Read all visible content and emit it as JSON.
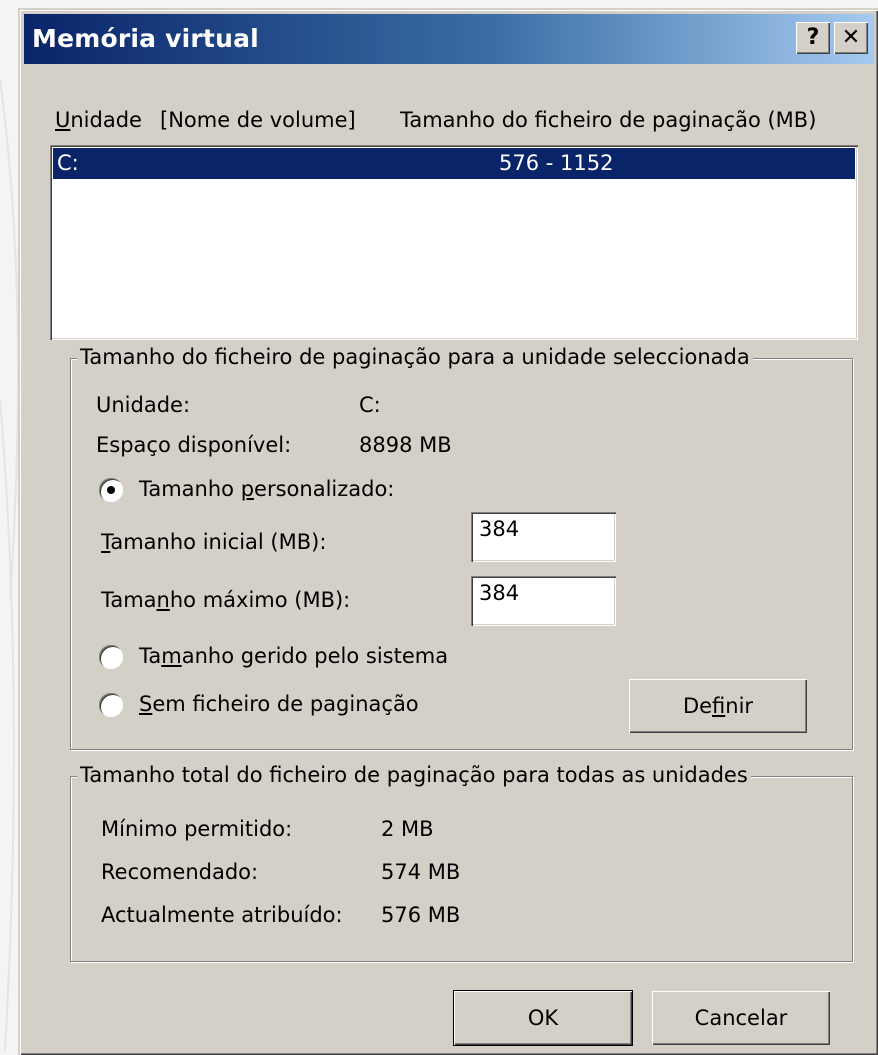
{
  "window": {
    "title": "Memória virtual",
    "help_label": "?",
    "close_label": "✕"
  },
  "list": {
    "headers": {
      "unit_access_key": "U",
      "unit_rest": "nidade",
      "volume": "[Nome de volume]",
      "size": "Tamanho do ficheiro de paginação (MB)"
    },
    "rows": [
      {
        "drive": "C:",
        "size": "576 - 1152"
      }
    ]
  },
  "selected_drive_group": {
    "legend": "Tamanho do ficheiro de paginação para a unidade seleccionada",
    "unit_label": "Unidade:",
    "unit_value": "C:",
    "space_label": "Espaço disponível:",
    "space_value": "8898 MB",
    "custom_size": {
      "label_pre": "Tamanho ",
      "label_key": "p",
      "label_post": "ersonalizado:",
      "selected": true
    },
    "initial_size": {
      "label_key": "T",
      "label_post": "amanho inicial (MB):",
      "value": "384"
    },
    "max_size": {
      "label_pre": "Tama",
      "label_key": "n",
      "label_post": "ho máximo (MB):",
      "value": "384"
    },
    "system_managed": {
      "label_pre": "Ta",
      "label_key": "m",
      "label_post": "anho gerido pelo sistema",
      "selected": false
    },
    "no_paging": {
      "label_key": "S",
      "label_post": "em ficheiro de paginação",
      "selected": false
    },
    "set_button": {
      "label_pre": "De",
      "label_key": "f",
      "label_post": "inir"
    }
  },
  "total_group": {
    "legend": "Tamanho total do ficheiro de paginação para todas as unidades",
    "min_label": "Mínimo permitido:",
    "min_value": "2 MB",
    "recommended_label": "Recomendado:",
    "recommended_value": "574 MB",
    "allocated_label": "Actualmente atribuído:",
    "allocated_value": "576 MB"
  },
  "buttons": {
    "ok": "OK",
    "cancel": "Cancelar"
  }
}
